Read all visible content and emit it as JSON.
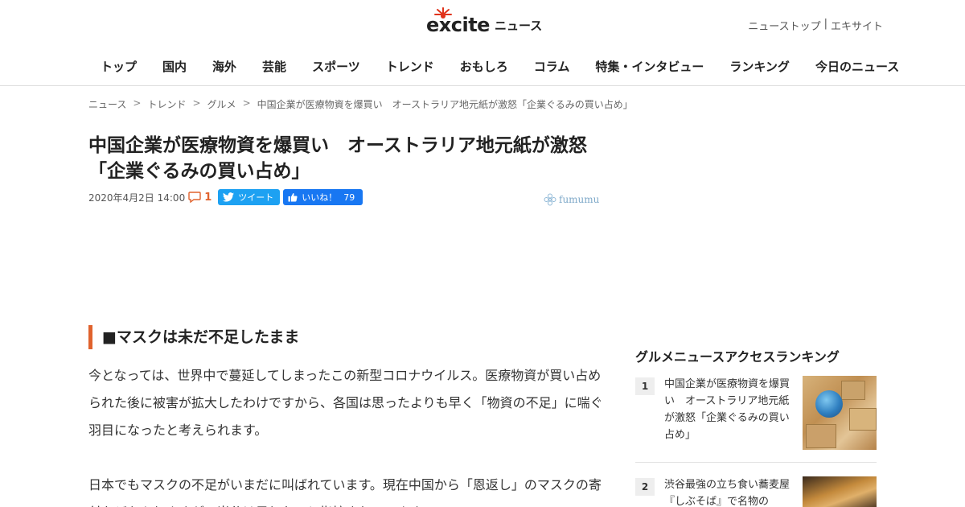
{
  "header": {
    "logo_text": "excite",
    "logo_suffix": "ニュース",
    "top_links": [
      "ニューストップ",
      "エキサイト"
    ],
    "top_links_separator": "|",
    "nav": [
      "トップ",
      "国内",
      "海外",
      "芸能",
      "スポーツ",
      "トレンド",
      "おもしろ",
      "コラム",
      "特集・インタビュー",
      "ランキング",
      "今日のニュース"
    ]
  },
  "breadcrumb": {
    "items": [
      "ニュース",
      "トレンド",
      "グルメ",
      "中国企業が医療物資を爆買い　オーストラリア地元紙が激怒「企業ぐるみの買い占め」"
    ],
    "separator": ">"
  },
  "article": {
    "title": "中国企業が医療物資を爆買い　オーストラリア地元紙が激怒「企業ぐるみの買い占め」",
    "date": "2020年4月2日 14:00",
    "comment_count": "1",
    "tweet_label": "ツイート",
    "like_label": "いいね！",
    "like_count": "79",
    "source": "fumumu",
    "heading": "■マスクは未だ不足したまま",
    "para1": "今となっては、世界中で蔓延してしまったこの新型コロナウイルス。医療物資が買い占められた後に被害が拡大したわけですから、各国は思ったよりも早く「物資の不足」に喘ぐ羽目になったと考えられます。",
    "para2": "日本でもマスクの不足がいまだに叫ばれています。現在中国から「恩返し」のマスクの寄付などもありますが、当分は足りないと指摘されています。"
  },
  "sidebar": {
    "title": "グルメニュースアクセスランキング",
    "items": [
      {
        "rank": "1",
        "text": "中国企業が医療物資を爆買い　オーストラリア地元紙が激怒「企業ぐるみの買い占め」"
      },
      {
        "rank": "2",
        "text": "渋谷最強の立ち食い蕎麦屋『しぶそば』で名物の"
      }
    ]
  },
  "colors": {
    "accent": "#e0622d",
    "twitter": "#1da1f2",
    "facebook": "#1877f2"
  }
}
